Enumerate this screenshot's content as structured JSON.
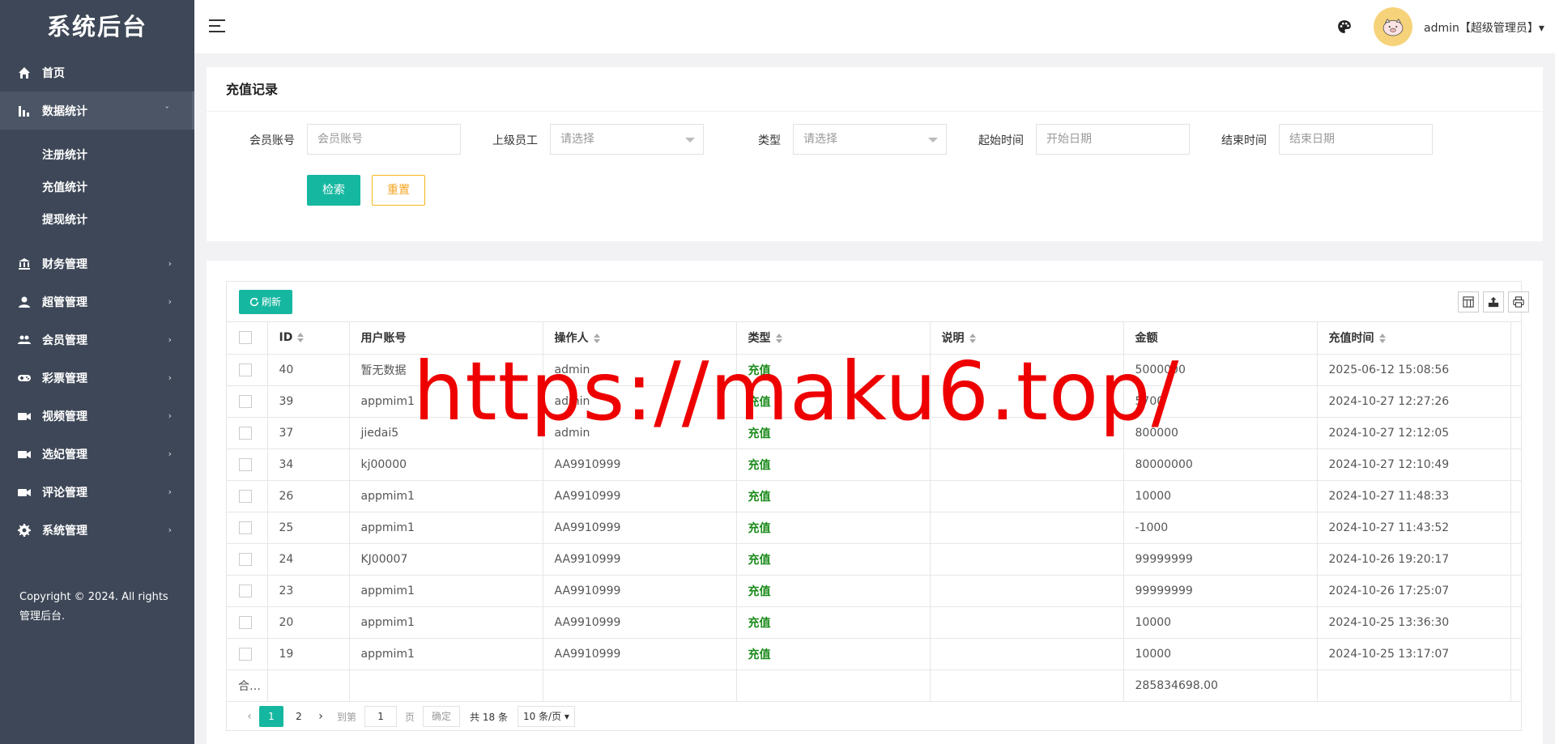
{
  "sidebar": {
    "brand": "系统后台",
    "items": [
      {
        "label": "首页",
        "icon": "home-icon"
      },
      {
        "label": "数据统计",
        "icon": "bar-chart-icon",
        "chevron": "ˇ"
      },
      {
        "label": "财务管理",
        "icon": "bank-icon",
        "chevron": "›"
      },
      {
        "label": "超管管理",
        "icon": "user-icon",
        "chevron": "›"
      },
      {
        "label": "会员管理",
        "icon": "users-icon",
        "chevron": "›"
      },
      {
        "label": "彩票管理",
        "icon": "gamepad-icon",
        "chevron": "›"
      },
      {
        "label": "视频管理",
        "icon": "video-icon",
        "chevron": "›"
      },
      {
        "label": "选妃管理",
        "icon": "video-icon",
        "chevron": "›"
      },
      {
        "label": "评论管理",
        "icon": "video-icon",
        "chevron": "›"
      },
      {
        "label": "系统管理",
        "icon": "gear-icon",
        "chevron": "›"
      }
    ],
    "subitems": [
      "注册统计",
      "充值统计",
      "提现统计"
    ],
    "copyright": "Copyright © 2024. All rights 管理后台."
  },
  "header": {
    "user": "admin【超级管理员】▾"
  },
  "search": {
    "title": "充值记录",
    "member_label": "会员账号",
    "member_placeholder": "会员账号",
    "staff_label": "上级员工",
    "staff_value": "请选择",
    "type_label": "类型",
    "type_value": "请选择",
    "start_label": "起始时间",
    "start_placeholder": "开始日期",
    "end_label": "结束时间",
    "end_placeholder": "结束日期",
    "search_btn": "检索",
    "reset_btn": "重置"
  },
  "table": {
    "refresh": "刷新",
    "columns": [
      "ID",
      "用户账号",
      "操作人",
      "类型",
      "说明",
      "金额",
      "充值时间"
    ],
    "rows": [
      [
        "40",
        "暂无数据",
        "admin",
        "充值",
        "",
        "5000000",
        "2025-06-12 15:08:56"
      ],
      [
        "39",
        "appmim1",
        "admin",
        "充值",
        "",
        "5700",
        "2024-10-27 12:27:26"
      ],
      [
        "37",
        "jiedai5",
        "admin",
        "充值",
        "",
        "800000",
        "2024-10-27 12:12:05"
      ],
      [
        "34",
        "kj00000",
        "AA9910999",
        "充值",
        "",
        "80000000",
        "2024-10-27 12:10:49"
      ],
      [
        "26",
        "appmim1",
        "AA9910999",
        "充值",
        "",
        "10000",
        "2024-10-27 11:48:33"
      ],
      [
        "25",
        "appmim1",
        "AA9910999",
        "充值",
        "",
        "-1000",
        "2024-10-27 11:43:52"
      ],
      [
        "24",
        "KJ00007",
        "AA9910999",
        "充值",
        "",
        "99999999",
        "2024-10-26 19:20:17"
      ],
      [
        "23",
        "appmim1",
        "AA9910999",
        "充值",
        "",
        "99999999",
        "2024-10-26 17:25:07"
      ],
      [
        "20",
        "appmim1",
        "AA9910999",
        "充值",
        "",
        "10000",
        "2024-10-25 13:36:30"
      ],
      [
        "19",
        "appmim1",
        "AA9910999",
        "充值",
        "",
        "10000",
        "2024-10-25 13:17:07"
      ]
    ],
    "total_label": "合…",
    "total_amount": "285834698.00"
  },
  "pager": {
    "pages": [
      "1",
      "2"
    ],
    "goto_label": "到第",
    "goto_value": "1",
    "page_unit": "页",
    "ok": "确定",
    "total": "共 18 条",
    "page_size": "10 条/页 ▾"
  },
  "watermark": "https://maku6.top/"
}
